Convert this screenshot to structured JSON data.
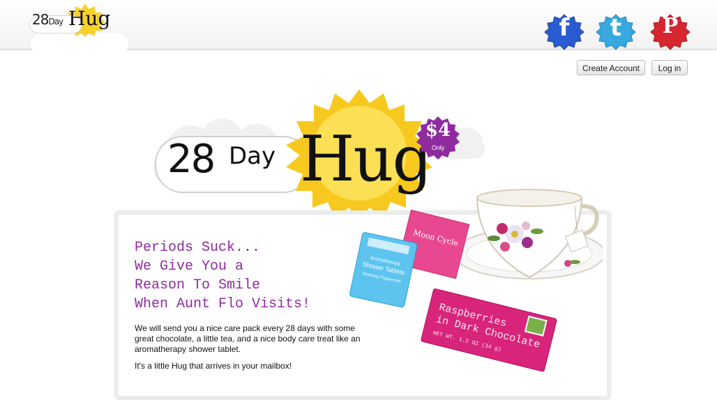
{
  "header": {
    "logo": {
      "part1": "28",
      "part2": "Day",
      "part3": "Hug"
    },
    "social": [
      {
        "name": "facebook",
        "glyph": "f",
        "color": "#2a5bd0"
      },
      {
        "name": "twitter",
        "glyph": "t",
        "color": "#38a9e0"
      },
      {
        "name": "pinterest",
        "glyph": "P",
        "color": "#d6262f"
      }
    ],
    "create_account_label": "Create Account",
    "login_label": "Log in"
  },
  "hero": {
    "part1": "28",
    "part2": "Day",
    "part3": "Hug",
    "price": "$4",
    "price_note": "Only",
    "sun_color": "#f7d12a",
    "badge_color": "#8e2b9e"
  },
  "content": {
    "headline": [
      "Periods Suck...",
      "We Give You a",
      "Reason To Smile",
      "When Aunt Flo Visits!"
    ],
    "headline_color": "#8e2b9e",
    "description": "We will send you a nice care pack every 28 days with some great chocolate, a little tea, and a nice body care treat like an aromatherapy shower tablet.",
    "tagline": "It's a little Hug that arrives in your mailbox!"
  },
  "product": {
    "tea_label_line1": "Moon Cycle",
    "tablet_line1": "Aromatherapy",
    "tablet_line2": "Shower Tablets",
    "tablet_line3": "Relaxing Peppermint",
    "chocolate_line1": "Raspberries",
    "chocolate_line2": "in Dark Chocolate",
    "chocolate_weight": "NET WT. 1.2 OZ (34 g)"
  }
}
